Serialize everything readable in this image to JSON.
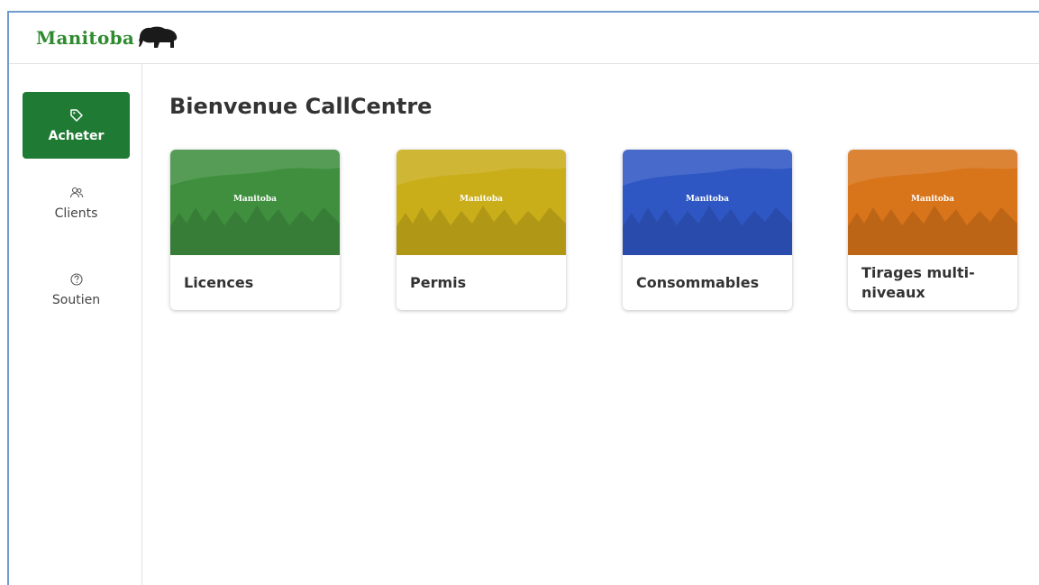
{
  "header": {
    "logo_text": "Manitoba"
  },
  "sidebar": {
    "items": [
      {
        "label": "Acheter",
        "icon": "tag-icon",
        "active": true
      },
      {
        "label": "Clients",
        "icon": "users-icon",
        "active": false
      },
      {
        "label": "Soutien",
        "icon": "help-circle-icon",
        "active": false
      }
    ]
  },
  "main": {
    "title": "Bienvenue CallCentre",
    "cards": [
      {
        "label": "Licences",
        "image_text": "Manitoba",
        "color": "#3f8f3f"
      },
      {
        "label": "Permis",
        "image_text": "Manitoba",
        "color": "#c9ae1a"
      },
      {
        "label": "Consommables",
        "image_text": "Manitoba",
        "color": "#2f57c4"
      },
      {
        "label": "Tirages multi-niveaux",
        "image_text": "Manitoba",
        "color": "#d8741a"
      }
    ]
  },
  "colors": {
    "brand_green": "#2e8b2e",
    "active_nav": "#1f7a34",
    "frame_blue": "#6f9bd0"
  }
}
